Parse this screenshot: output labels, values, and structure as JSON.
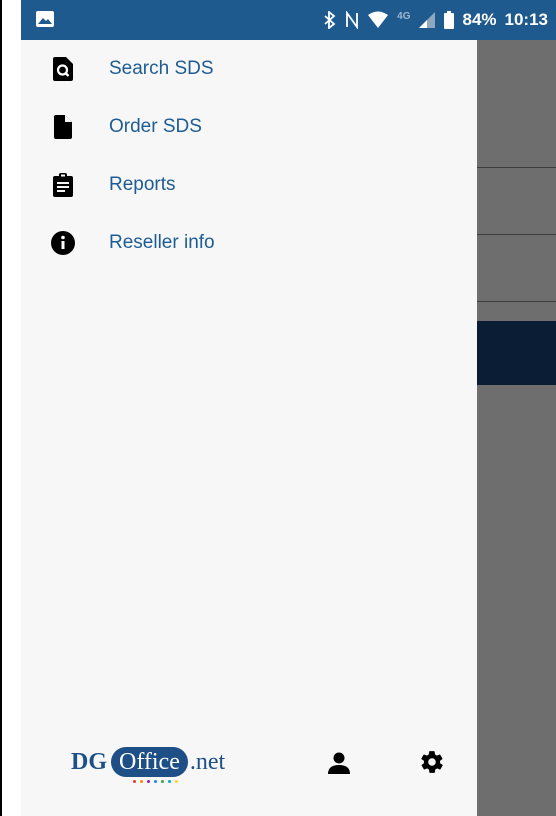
{
  "status_bar": {
    "battery": "84%",
    "time": "10:13",
    "network": "4G",
    "icons": [
      "gallery-icon",
      "bluetooth-icon",
      "nfc-icon",
      "wifi-icon",
      "signal-icon",
      "battery-icon"
    ]
  },
  "drawer": {
    "items": [
      {
        "label": "Search SDS",
        "icon": "search-document-icon"
      },
      {
        "label": "Order SDS",
        "icon": "document-icon"
      },
      {
        "label": "Reports",
        "icon": "clipboard-icon"
      },
      {
        "label": "Reseller info",
        "icon": "info-icon"
      }
    ],
    "footer": {
      "logo_dg": "DG",
      "logo_office": "Office",
      "logo_net": ".net",
      "icons": [
        "user-icon",
        "gear-icon"
      ]
    }
  },
  "colors": {
    "status_bar": "#1e5a8e",
    "accent_text": "#1f5c93",
    "drawer_bg": "#f7f7f7",
    "scrim": "#6e6e6e",
    "logo_blue": "#1e4f86"
  }
}
